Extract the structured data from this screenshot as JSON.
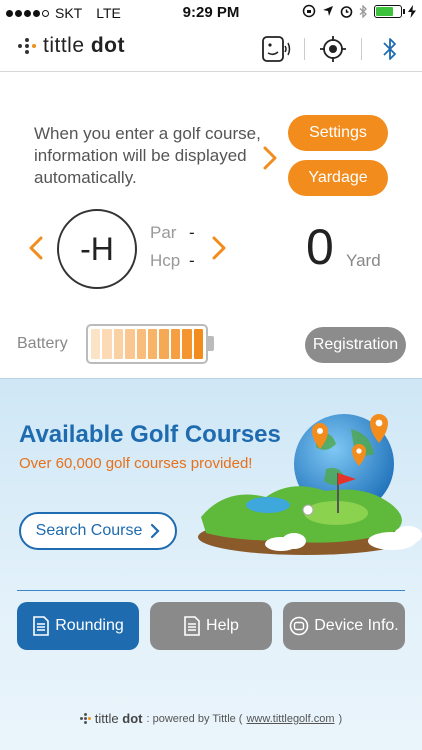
{
  "status_bar": {
    "carrier": "SKT",
    "network": "LTE",
    "time": "9:29 PM",
    "signal_bars": 4,
    "battery_level": 0.72
  },
  "header": {
    "logo_prefix": "tittle",
    "logo_suffix": "dot",
    "icons": [
      "voice-icon",
      "crosshair-icon",
      "bluetooth-icon"
    ]
  },
  "info": {
    "message": "When you enter a golf course, information will be displayed automatically.",
    "settings_label": "Settings",
    "yardage_label": "Yardage",
    "hole": "-H",
    "par_label": "Par",
    "par_value": "-",
    "hcp_label": "Hcp",
    "hcp_value": "-",
    "yard_value": "0",
    "yard_label": "Yard",
    "battery_label": "Battery",
    "device_battery_level": 1.0,
    "registration_label": "Registration"
  },
  "course": {
    "title": "Available Golf Courses",
    "subtitle": "Over 60,000 golf courses provided!",
    "search_label": "Search Course"
  },
  "bottom_nav": {
    "rounding_label": "Rounding",
    "help_label": "Help",
    "device_label": "Device Info."
  },
  "footer": {
    "brand_prefix": "tittle",
    "brand_suffix": "dot",
    "powered": ": powered by Tittle (",
    "link": "www.tittlegolf.com",
    "close": ")"
  },
  "colors": {
    "accent_orange": "#f28c1d",
    "brand_blue": "#1e6bb0",
    "button_gray": "#8a8a8a"
  }
}
